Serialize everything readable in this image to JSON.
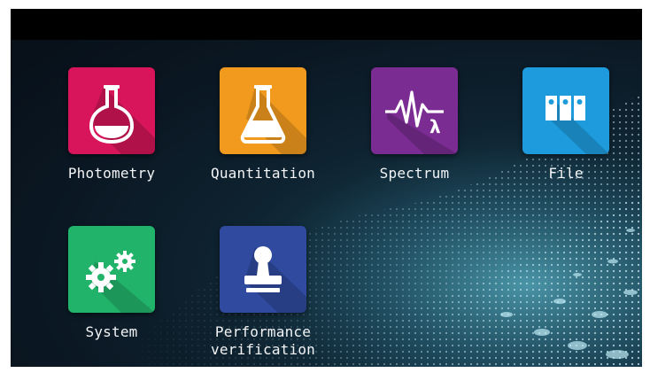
{
  "apps": [
    {
      "label": "Photometry",
      "icon": "flask-icon",
      "color": "#d8155a"
    },
    {
      "label": "Quantitation",
      "icon": "beaker-icon",
      "color": "#f29a1e"
    },
    {
      "label": "Spectrum",
      "icon": "spectrum-wave-icon",
      "color": "#7b2c93"
    },
    {
      "label": "File",
      "icon": "binders-icon",
      "color": "#1e9bdc"
    },
    {
      "label": "System",
      "icon": "gears-icon",
      "color": "#22b36a"
    },
    {
      "label_line1": "Performance",
      "label_line2": "verification",
      "icon": "stamp-icon",
      "color": "#2f4a9e"
    }
  ]
}
